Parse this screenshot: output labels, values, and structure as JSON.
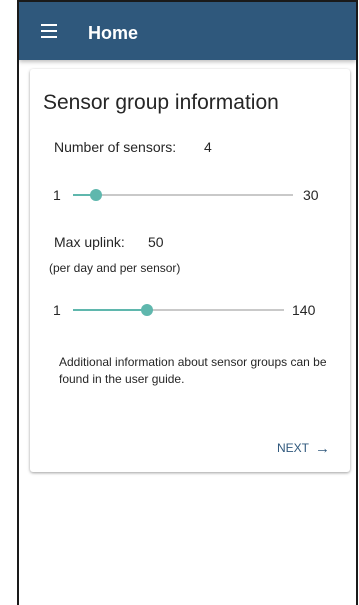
{
  "appbar": {
    "title": "Home"
  },
  "card": {
    "title": "Sensor group information",
    "sensors": {
      "label": "Number of sensors:",
      "value": "4",
      "min": "1",
      "max": "30",
      "level": 0.103
    },
    "uplink": {
      "label": "Max uplink:",
      "value": "50",
      "note": "(per day and per sensor)",
      "min": "1",
      "max": "140",
      "level": 0.353
    },
    "info": "Additional information about sensor groups can be found in the user guide.",
    "next_label": "NEXT",
    "next_arrow": "→"
  },
  "colors": {
    "appbar": "#2f587c",
    "accent": "#5fb7ad",
    "track": "#c9c9c9"
  },
  "icons": {
    "menu": "hamburger-menu-icon",
    "next": "arrow-right-icon"
  }
}
